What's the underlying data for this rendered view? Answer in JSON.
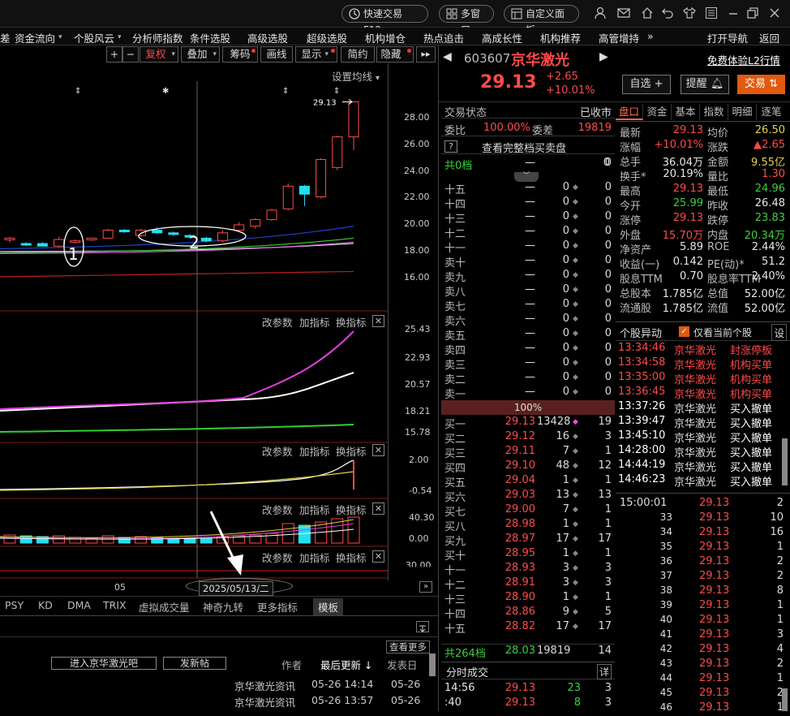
{
  "titlebar": {
    "fast_trade": "快速交易F12",
    "multi_window": "多窗口",
    "custom_panel": "自定义面板"
  },
  "menu": [
    "资金流向",
    "个股风云",
    "分析师指数",
    "条件选股",
    "高级选股",
    "超级选股",
    "机构增仓",
    "热点追击",
    "高成长性",
    "机构推荐",
    "高管增持",
    "打开导航",
    "返回"
  ],
  "menu_more": "»",
  "menu_left_partial": "差",
  "toolbar": {
    "plus": "+",
    "minus": "−",
    "fuquan": "复权",
    "diejia": "叠加",
    "chouma": "筹码",
    "huaxian": "画线",
    "xianshi": "显示",
    "jianyue": "简约",
    "yincang": "隐藏"
  },
  "chart": {
    "ma_settings": "设置均线",
    "price_label": "29.13",
    "price_axis": [
      "28.00",
      "26.00",
      "24.00",
      "22.00",
      "20.00",
      "18.00",
      "16.00"
    ],
    "annot_1": "1",
    "annot_2": "2",
    "date_label": "2025/05/13/二",
    "x_month": "05",
    "panel_actions": [
      "改参数",
      "加指标",
      "换指标"
    ],
    "panel2_axis": [
      "25.43",
      "22.93",
      "20.57",
      "18.21",
      "15.78"
    ],
    "panel3_axis": [
      "2.00",
      "-0.54"
    ],
    "panel4_axis": [
      "40.30",
      "0.00"
    ],
    "panel5_axis": [
      "30.00"
    ],
    "close_x": "✕",
    "indicator_tabs": [
      "PSY",
      "KD",
      "DMA",
      "TRIX",
      "虚拟成交量",
      "神奇九转",
      "更多指标",
      "模板"
    ]
  },
  "chart_data": {
    "type": "candlestick",
    "title": "",
    "ylim": [
      15,
      31
    ],
    "ohlc": [
      {
        "o": 18.8,
        "c": 18.9,
        "h": 19.0,
        "l": 18.6,
        "color": "red"
      },
      {
        "o": 18.5,
        "c": 18.4,
        "h": 18.6,
        "l": 18.3,
        "color": "cyan"
      },
      {
        "o": 18.5,
        "c": 18.3,
        "h": 18.6,
        "l": 18.3,
        "color": "cyan"
      },
      {
        "o": 18.3,
        "c": 18.8,
        "h": 19.0,
        "l": 18.2,
        "color": "red"
      },
      {
        "o": 18.7,
        "c": 18.6,
        "h": 18.8,
        "l": 18.5,
        "color": "red"
      },
      {
        "o": 18.8,
        "c": 18.9,
        "h": 18.9,
        "l": 18.7,
        "color": "red"
      },
      {
        "o": 18.9,
        "c": 19.5,
        "h": 19.6,
        "l": 18.9,
        "color": "red"
      },
      {
        "o": 19.5,
        "c": 19.4,
        "h": 19.6,
        "l": 19.3,
        "color": "cyan"
      },
      {
        "o": 19.1,
        "c": 19.5,
        "h": 19.6,
        "l": 19.0,
        "color": "red"
      },
      {
        "o": 19.5,
        "c": 19.3,
        "h": 19.7,
        "l": 19.2,
        "color": "cyan"
      },
      {
        "o": 19.3,
        "c": 19.2,
        "h": 19.4,
        "l": 19.1,
        "color": "cyan"
      },
      {
        "o": 19.1,
        "c": 19.0,
        "h": 19.2,
        "l": 18.9,
        "color": "cyan"
      },
      {
        "o": 18.9,
        "c": 18.7,
        "h": 19.0,
        "l": 18.6,
        "color": "cyan"
      },
      {
        "o": 18.7,
        "c": 19.3,
        "h": 19.5,
        "l": 18.6,
        "color": "red"
      },
      {
        "o": 19.5,
        "c": 19.9,
        "h": 20.1,
        "l": 19.4,
        "color": "red"
      },
      {
        "o": 19.8,
        "c": 20.3,
        "h": 20.4,
        "l": 19.6,
        "color": "red"
      },
      {
        "o": 20.3,
        "c": 21.0,
        "h": 21.1,
        "l": 20.2,
        "color": "red"
      },
      {
        "o": 21.1,
        "c": 22.8,
        "h": 23.0,
        "l": 21.0,
        "color": "red"
      },
      {
        "o": 22.8,
        "c": 22.2,
        "h": 22.9,
        "l": 21.3,
        "color": "cyan"
      },
      {
        "o": 22.0,
        "c": 24.8,
        "h": 24.9,
        "l": 21.9,
        "color": "red"
      },
      {
        "o": 24.2,
        "c": 26.5,
        "h": 26.6,
        "l": 24.0,
        "color": "red"
      },
      {
        "o": 26.5,
        "c": 29.13,
        "h": 29.13,
        "l": 25.5,
        "color": "red"
      }
    ]
  },
  "stock": {
    "code": "603607",
    "name": "京华激光",
    "price": "29.13",
    "change": "+2.65",
    "change_pct": "+10.01%",
    "l2_link": "免费体验L2行情",
    "btn_zixuan": "自选 +",
    "btn_tixing": "提醒",
    "btn_jiaoyi": "交易",
    "status_label": "交易状态",
    "status_value": "已收市",
    "weibi_label": "委比",
    "weibi_value": "100.00%",
    "weicha_label": "委差",
    "weicha_value": "19819",
    "full_book": "查看完整档买卖盘",
    "q_mark": "?",
    "top_row": {
      "label": "共0档",
      "price": "—",
      "vol": "0",
      "cnt": "0"
    },
    "sell_rows": [
      {
        "label": "十五",
        "price": "—",
        "vol": "0",
        "cnt": "0"
      },
      {
        "label": "十四",
        "price": "—",
        "vol": "0",
        "cnt": "0"
      },
      {
        "label": "十三",
        "price": "—",
        "vol": "0",
        "cnt": "0"
      },
      {
        "label": "十二",
        "price": "—",
        "vol": "0",
        "cnt": "0"
      },
      {
        "label": "十一",
        "price": "—",
        "vol": "0",
        "cnt": "0"
      },
      {
        "label": "卖十",
        "price": "—",
        "vol": "0",
        "cnt": "0"
      },
      {
        "label": "卖九",
        "price": "—",
        "vol": "0",
        "cnt": "0"
      },
      {
        "label": "卖八",
        "price": "—",
        "vol": "0",
        "cnt": "0"
      },
      {
        "label": "卖七",
        "price": "—",
        "vol": "0",
        "cnt": "0"
      },
      {
        "label": "卖六",
        "price": "—",
        "vol": "0",
        "cnt": "0"
      },
      {
        "label": "卖五",
        "price": "—",
        "vol": "0",
        "cnt": "0"
      },
      {
        "label": "卖四",
        "price": "—",
        "vol": "0",
        "cnt": "0"
      },
      {
        "label": "卖三",
        "price": "—",
        "vol": "0",
        "cnt": "0"
      },
      {
        "label": "卖二",
        "price": "—",
        "vol": "0",
        "cnt": "0"
      },
      {
        "label": "卖一",
        "price": "—",
        "vol": "0",
        "cnt": "0"
      }
    ],
    "ratio_bar": "100%",
    "buy_rows": [
      {
        "label": "买一",
        "price": "29.13",
        "vol": "13428",
        "cnt": "19"
      },
      {
        "label": "买二",
        "price": "29.12",
        "vol": "16",
        "cnt": "3"
      },
      {
        "label": "买三",
        "price": "29.11",
        "vol": "7",
        "cnt": "1"
      },
      {
        "label": "买四",
        "price": "29.10",
        "vol": "48",
        "cnt": "12"
      },
      {
        "label": "买五",
        "price": "29.04",
        "vol": "1",
        "cnt": "1"
      },
      {
        "label": "买六",
        "price": "29.03",
        "vol": "13",
        "cnt": "13"
      },
      {
        "label": "买七",
        "price": "29.00",
        "vol": "7",
        "cnt": "1"
      },
      {
        "label": "买八",
        "price": "28.98",
        "vol": "1",
        "cnt": "1"
      },
      {
        "label": "买九",
        "price": "28.97",
        "vol": "17",
        "cnt": "17"
      },
      {
        "label": "买十",
        "price": "28.95",
        "vol": "1",
        "cnt": "1"
      },
      {
        "label": "十一",
        "price": "28.93",
        "vol": "3",
        "cnt": "3"
      },
      {
        "label": "十二",
        "price": "28.91",
        "vol": "3",
        "cnt": "3"
      },
      {
        "label": "十三",
        "price": "28.90",
        "vol": "1",
        "cnt": "1"
      },
      {
        "label": "十四",
        "price": "28.86",
        "vol": "9",
        "cnt": "5"
      },
      {
        "label": "十五",
        "price": "28.82",
        "vol": "17",
        "cnt": "17"
      }
    ],
    "total_buy": {
      "label": "共264档",
      "price": "28.03",
      "vol": "19819",
      "cnt": "14"
    },
    "fenshi_title": "分时成交",
    "fenshi_detail": "详",
    "fenshi_rows": [
      {
        "time": "14:56",
        "price": "29.13",
        "vol": "23",
        "cnt": "3"
      },
      {
        "time": ":40",
        "price": "29.13",
        "vol": "8",
        "cnt": "3"
      }
    ]
  },
  "quote_tabs": [
    "盘口",
    "资金",
    "基本",
    "指数",
    "明细",
    "逐笔"
  ],
  "quote": [
    {
      "l1": "最新",
      "v1": "29.13",
      "c1": "red",
      "l2": "均价",
      "v2": "26.50",
      "c2": "yellow"
    },
    {
      "l1": "涨幅",
      "v1": "+10.01%",
      "c1": "red",
      "l2": "涨跌",
      "v2": "▲2.65",
      "c2": "red"
    },
    {
      "l1": "总手",
      "v1": "36.04万",
      "c1": "white",
      "l2": "金额",
      "v2": "9.55亿",
      "c2": "yellow"
    },
    {
      "l1": "换手*",
      "v1": "20.19%",
      "c1": "white",
      "l2": "量比",
      "v2": "1.30",
      "c2": "red"
    },
    {
      "l1": "最高",
      "v1": "29.13",
      "c1": "red",
      "l2": "最低",
      "v2": "24.96",
      "c2": "green"
    },
    {
      "l1": "今开",
      "v1": "25.99",
      "c1": "green",
      "l2": "昨收",
      "v2": "26.48",
      "c2": "white"
    },
    {
      "l1": "涨停",
      "v1": "29.13",
      "c1": "red",
      "l2": "跌停",
      "v2": "23.83",
      "c2": "green"
    },
    {
      "l1": "外盘",
      "v1": "15.70万",
      "c1": "red",
      "l2": "内盘",
      "v2": "20.34万",
      "c2": "green"
    },
    {
      "l1": "净资产",
      "v1": "5.89",
      "c1": "white",
      "l2": "ROE",
      "v2": "2.44%",
      "c2": "white"
    },
    {
      "l1": "收益(一)",
      "v1": "0.142",
      "c1": "white",
      "l2": "PE(动)*",
      "v2": "51.2",
      "c2": "white"
    },
    {
      "l1": "股息TTM",
      "v1": "0.70",
      "c1": "white",
      "l2": "股息率TTM",
      "v2": "2.40%",
      "c2": "white"
    },
    {
      "l1": "总股本",
      "v1": "1.785亿",
      "c1": "white",
      "l2": "总值",
      "v2": "52.00亿",
      "c2": "white"
    },
    {
      "l1": "流通股",
      "v1": "1.785亿",
      "c1": "white",
      "l2": "流值",
      "v2": "52.00亿",
      "c2": "white"
    }
  ],
  "events": {
    "title": "个股异动",
    "checkbox_label": "仅看当前个股",
    "settings": "设",
    "rows": [
      {
        "time": "13:34:46",
        "name": "京华激光",
        "type": "封涨停板",
        "color": "red"
      },
      {
        "time": "13:34:58",
        "name": "京华激光",
        "type": "机构买单",
        "color": "red"
      },
      {
        "time": "13:35:00",
        "name": "京华激光",
        "type": "机构买单",
        "color": "red"
      },
      {
        "time": "13:36:45",
        "name": "京华激光",
        "type": "机构买单",
        "color": "red"
      },
      {
        "time": "13:37:26",
        "name": "京华激光",
        "type": "买入撤单",
        "color": "white"
      },
      {
        "time": "13:39:47",
        "name": "京华激光",
        "type": "买入撤单",
        "color": "white"
      },
      {
        "time": "13:45:10",
        "name": "京华激光",
        "type": "买入撤单",
        "color": "white"
      },
      {
        "time": "14:28:00",
        "name": "京华激光",
        "type": "买入撤单",
        "color": "white"
      },
      {
        "time": "14:44:19",
        "name": "京华激光",
        "type": "买入撤单",
        "color": "white"
      },
      {
        "time": "14:46:23",
        "name": "京华激光",
        "type": "买入撤单",
        "color": "white"
      }
    ]
  },
  "ticks": [
    {
      "t": "15:00:01",
      "p": "29.13",
      "v": "2"
    },
    {
      "t": "33",
      "p": "29.13",
      "v": "10"
    },
    {
      "t": "34",
      "p": "29.13",
      "v": "16"
    },
    {
      "t": "35",
      "p": "29.13",
      "v": "1"
    },
    {
      "t": "36",
      "p": "29.13",
      "v": "2"
    },
    {
      "t": "37",
      "p": "29.13",
      "v": "2"
    },
    {
      "t": "38",
      "p": "29.13",
      "v": "8"
    },
    {
      "t": "39",
      "p": "29.13",
      "v": "1"
    },
    {
      "t": "40",
      "p": "29.13",
      "v": "1"
    },
    {
      "t": "41",
      "p": "29.13",
      "v": "3"
    },
    {
      "t": "42",
      "p": "29.13",
      "v": "4"
    },
    {
      "t": "43",
      "p": "29.13",
      "v": "2"
    },
    {
      "t": "44",
      "p": "29.13",
      "v": "1"
    },
    {
      "t": "45",
      "p": "29.13",
      "v": "2"
    },
    {
      "t": "46",
      "p": "29.13",
      "v": "1"
    }
  ],
  "news": {
    "enter_bar": "进入京华激光吧",
    "post": "发新帖",
    "author": "作者",
    "last_update": "最后更新",
    "post_date": "发表日",
    "more": "查看更多",
    "items": [
      {
        "title": "京华激光资讯",
        "update": "05-26 14:14",
        "date": "05-26"
      },
      {
        "title": "京华激光资讯",
        "update": "05-26 13:57",
        "date": "05-26"
      }
    ]
  }
}
